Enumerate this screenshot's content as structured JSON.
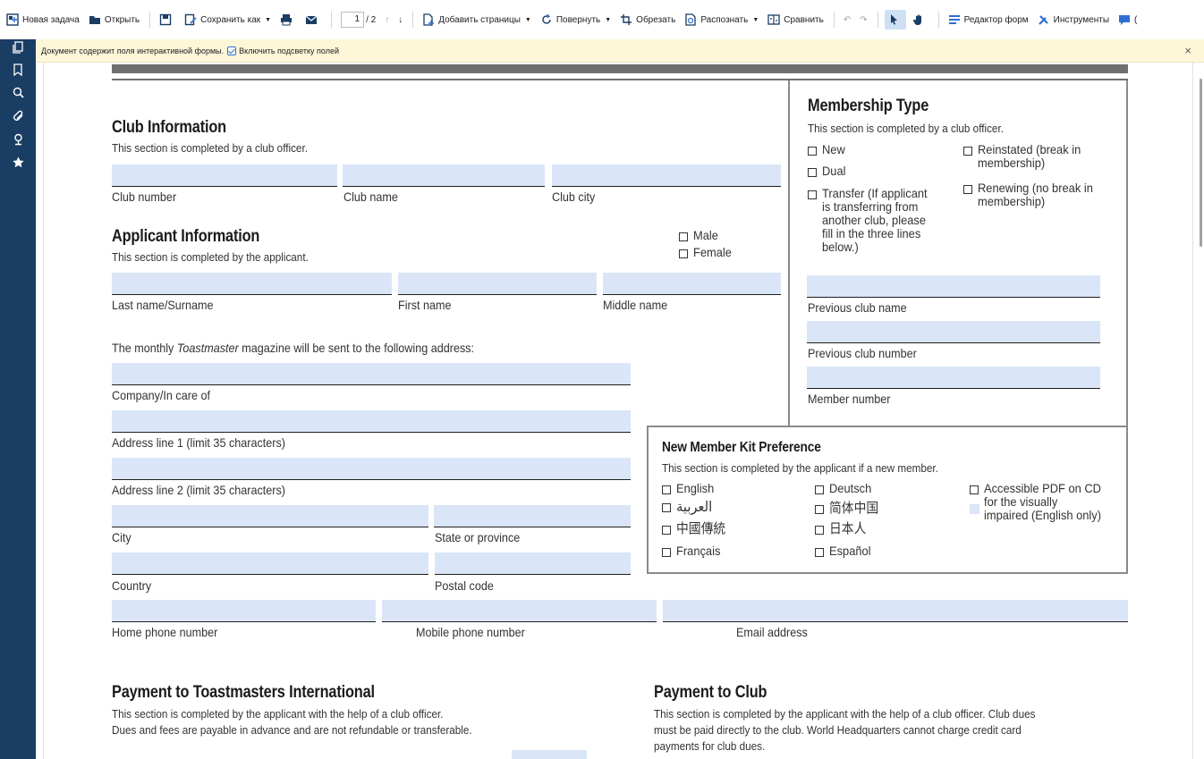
{
  "toolbar": {
    "new_task": "Новая задача",
    "open": "Открыть",
    "save_as": "Сохранить как",
    "current_page": "1",
    "total_pages": "/ 2",
    "add_pages": "Добавить страницы",
    "rotate": "Повернуть",
    "crop": "Обрезать",
    "recognize": "Распознать",
    "compare": "Сравнить",
    "form_editor": "Редактор форм",
    "tools": "Инструменты",
    "comments_partial": "("
  },
  "sidebar": {
    "icons": [
      "pages-icon",
      "bookmark-icon",
      "search-icon",
      "attachment-icon",
      "signature-icon",
      "star-icon"
    ]
  },
  "notification": {
    "message": "Документ содержит поля интерактивной формы.",
    "highlight_label": "Включить подсветку полей",
    "highlight_checked": true,
    "close": "×"
  },
  "form": {
    "club_info": {
      "title": "Club Information",
      "subtitle": "This section is completed by a club officer.",
      "labels": [
        "Club number",
        "Club name",
        "Club city"
      ]
    },
    "applicant": {
      "title": "Applicant Information",
      "subtitle": "This section is completed by the applicant.",
      "gender_options": [
        "Male",
        "Female"
      ],
      "name_labels": [
        "Last name/Surname",
        "First name",
        "Middle name"
      ],
      "magazine_prefix": "The monthly ",
      "magazine_name": "Toastmaster",
      "magazine_suffix": " magazine will be sent to the following address:",
      "address_labels": [
        "Company/In care of",
        "Address line 1 (limit 35 characters)",
        "Address line 2 (limit 35 characters)"
      ],
      "city": "City",
      "state": "State or province",
      "country": "Country",
      "postal": "Postal code",
      "phone_labels": [
        "Home phone number",
        "Mobile phone number",
        "Email address"
      ]
    },
    "membership": {
      "title": "Membership Type",
      "subtitle": "This section is completed by a club officer.",
      "new": "New",
      "dual": "Dual",
      "transfer": [
        "Transfer (If applicant",
        "is transferring from",
        "another club, please",
        "fill in the three lines",
        "below.)"
      ],
      "reinstated": [
        "Reinstated (break in",
        "membership)"
      ],
      "renewing": [
        "Renewing (no break in",
        "membership)"
      ],
      "field_labels": [
        "Previous club name",
        "Previous club number",
        "Member number"
      ]
    },
    "kit": {
      "title": "New Member Kit Preference",
      "subtitle": "This section is completed by the applicant if a new member.",
      "col1": [
        "English",
        "العربية",
        "中國傳統",
        "Français"
      ],
      "col2": [
        "Deutsch",
        "简体中国",
        "日本人",
        "Español"
      ],
      "accessible": [
        "Accessible PDF on CD",
        "for the visually",
        "impaired (English only)"
      ]
    },
    "payment_ti": {
      "title": "Payment to Toastmasters International",
      "lines": [
        "This section is completed by the applicant with the help of a club officer.",
        "Dues and fees are payable in advance and are not refundable or transferable."
      ]
    },
    "payment_club": {
      "title": "Payment to Club",
      "lines": [
        "This section is completed by the applicant with the help of a club officer. Club dues",
        "must be paid directly to the club. World Headquarters cannot charge credit card",
        "payments for club dues."
      ]
    }
  }
}
